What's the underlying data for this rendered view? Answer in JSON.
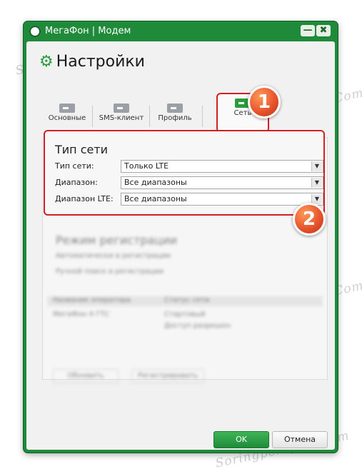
{
  "window": {
    "title": "МегаФон | Модем",
    "minimize_glyph": "—",
    "close_glyph": "✖"
  },
  "heading": {
    "icon": "gear-icon",
    "text": "Настройки"
  },
  "tabs": [
    {
      "label": "Основные",
      "icon": "key-icon"
    },
    {
      "label": "SMS-клиент",
      "icon": "key-icon"
    },
    {
      "label": "Профиль",
      "icon": "key-icon"
    },
    {
      "label": "Сеть",
      "icon": "key-icon",
      "active": true
    }
  ],
  "network": {
    "title": "Тип сети",
    "fields": [
      {
        "label": "Тип сети:",
        "value": "Только LTE"
      },
      {
        "label": "Диапазон:",
        "value": "Все диапазоны"
      },
      {
        "label": "Диапазон LTE:",
        "value": "Все диапазоны"
      }
    ]
  },
  "blurred": {
    "reg_title": "Режим регистрации",
    "opt1": "Автоматически в регистрации",
    "opt2": "Ручной поиск в регистрации",
    "col1": "Название оператора",
    "col2": "Статус сети",
    "cell1": "МегаФон 4 ГТС",
    "cell2": "Стартовый",
    "cell3": "Доступ разрешен",
    "btn1": "Обновить",
    "btn2": "Регистрировать"
  },
  "badges": {
    "one": "1",
    "two": "2"
  },
  "buttons": {
    "ok": "OK",
    "cancel": "Отмена"
  },
  "watermark": "Soringpcrepair.Com",
  "colors": {
    "accent": "#1f8a3a",
    "highlight": "#d21f24",
    "badge": "#e4502a"
  }
}
